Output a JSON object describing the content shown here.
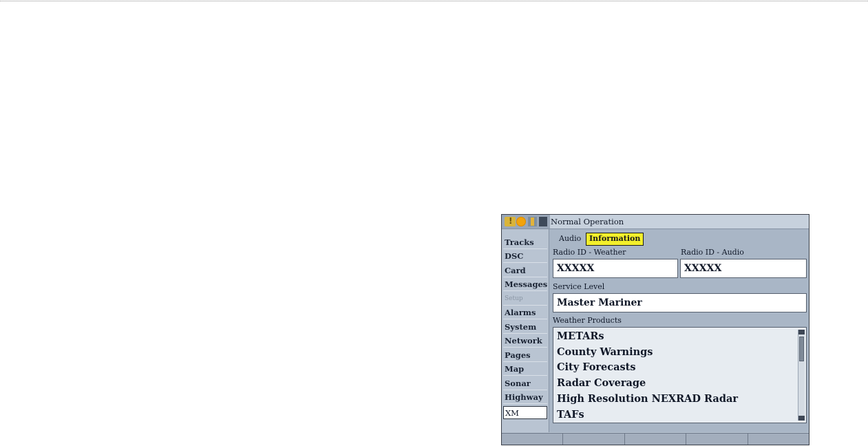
{
  "title_bar": {
    "title": "Normal Operation"
  },
  "icons": [
    "info-icon",
    "sun-icon",
    "tower-icon",
    "xm-icon"
  ],
  "nav": {
    "items": [
      {
        "label": "Tracks",
        "state": "normal"
      },
      {
        "label": "DSC",
        "state": "normal"
      },
      {
        "label": "Card",
        "state": "normal"
      },
      {
        "label": "Messages",
        "state": "normal"
      },
      {
        "label": "Setup",
        "state": "disabled"
      },
      {
        "label": "Alarms",
        "state": "normal"
      },
      {
        "label": "System",
        "state": "normal"
      },
      {
        "label": "Network",
        "state": "normal"
      },
      {
        "label": "Pages",
        "state": "normal"
      },
      {
        "label": "Map",
        "state": "normal"
      },
      {
        "label": "Sonar",
        "state": "normal"
      },
      {
        "label": "Highway",
        "state": "normal"
      },
      {
        "label": "XM",
        "state": "selected"
      }
    ]
  },
  "tabs": [
    {
      "label": "Audio",
      "active": false
    },
    {
      "label": "Information",
      "active": true
    }
  ],
  "info": {
    "radio_id_weather_label": "Radio ID - Weather",
    "radio_id_weather_value": "XXXXX",
    "radio_id_audio_label": "Radio ID - Audio",
    "radio_id_audio_value": "XXXXX",
    "service_level_label": "Service Level",
    "service_level_value": "Master Mariner",
    "weather_products_label": "Weather Products",
    "weather_products": [
      "METARs",
      "County Warnings",
      "City Forecasts",
      "Radar Coverage",
      "High Resolution NEXRAD Radar",
      "TAFs"
    ]
  },
  "softkeys": [
    "",
    "",
    "",
    "",
    ""
  ],
  "colors": {
    "active_tab": "#f3ef2b",
    "panel_bg": "#a9b6c6",
    "nav_bg": "#b9c4d2"
  }
}
